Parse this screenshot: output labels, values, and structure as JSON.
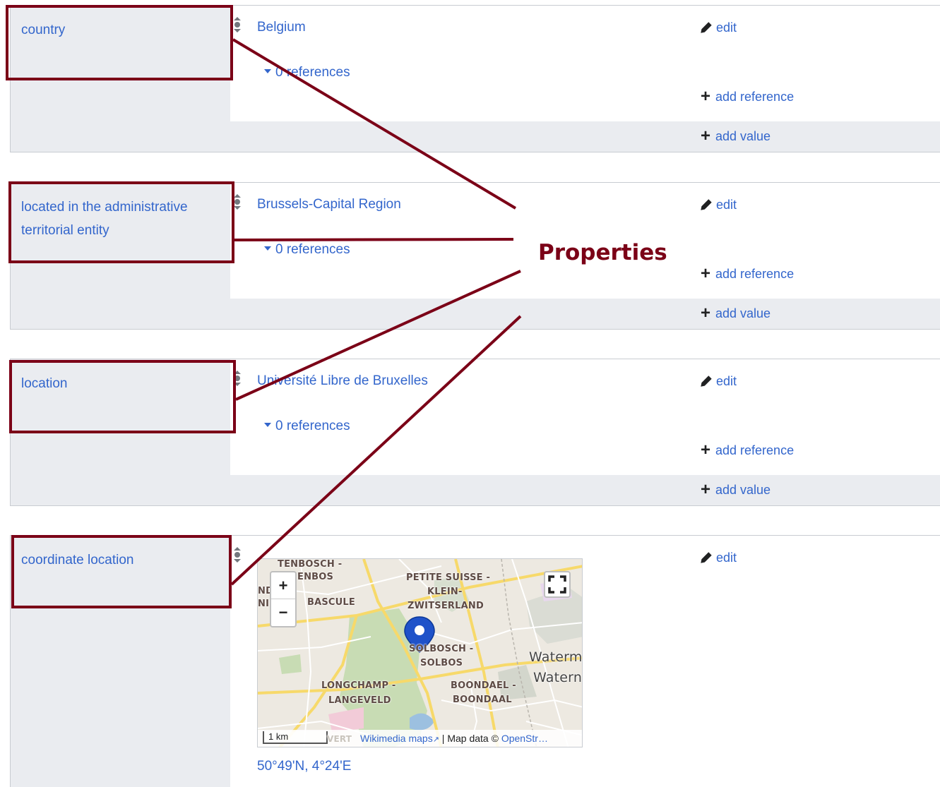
{
  "statements": [
    {
      "property": "country",
      "value": "Belgium",
      "references": "0 references",
      "edit": "edit",
      "add_reference": "add reference",
      "add_value": "add value"
    },
    {
      "property": "located in the administrative territorial entity",
      "value": "Brussels-Capital Region",
      "references": "0 references",
      "edit": "edit",
      "add_reference": "add reference",
      "add_value": "add value"
    },
    {
      "property": "location",
      "value": "Université Libre de Bruxelles",
      "references": "0 references",
      "edit": "edit",
      "add_reference": "add reference",
      "add_value": "add value"
    },
    {
      "property": "coordinate location",
      "edit": "edit",
      "coordinates": "50°49'N, 4°24'E",
      "map": {
        "labels": {
          "tenbosch": "TENBOSCH -",
          "enbos": "ENBOS",
          "petite_suisse": "PETITE SUISSE -",
          "klein": "KLEIN-",
          "zwitserland": "ZWITSERLAND",
          "nd": "ND",
          "ni": "NI",
          "bascule": "BASCULE",
          "solbosch": "SOLBOSCH -",
          "solbos": "SOLBOS",
          "waterm1": "Waterm",
          "waterm2": "Watern",
          "longchamp": "LONGCHAMP -",
          "langeveld": "LANGEVELD",
          "boondael": "BOONDAEL -",
          "boondaal": "BOONDAAL",
          "vert": "VERT"
        },
        "zoom_in": "+",
        "zoom_out": "−",
        "scale": "1 km",
        "attribution_link": "Wikimedia maps",
        "attribution_text": " | Map data © ",
        "attribution_link2": "OpenStr…"
      }
    }
  ],
  "annotation": {
    "title": "Properties",
    "color": "#7b0017"
  },
  "colors": {
    "link": "#3366cc",
    "property_bg": "#eaecf0",
    "border": "#c8ccd1",
    "marker": "#1f52c9"
  }
}
